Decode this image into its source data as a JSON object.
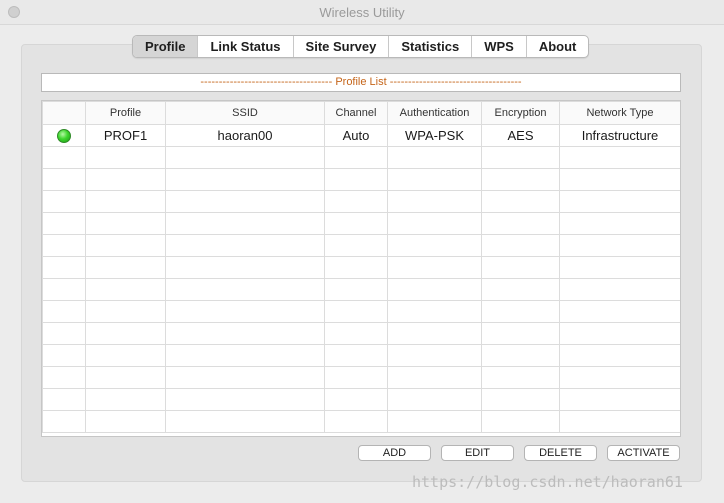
{
  "window": {
    "title": "Wireless Utility"
  },
  "tabs": [
    "Profile",
    "Link Status",
    "Site Survey",
    "Statistics",
    "WPS",
    "About"
  ],
  "active_tab": "Profile",
  "profile_list": {
    "header": "------------------------------------ Profile List ------------------------------------",
    "columns": [
      "",
      "Profile",
      "SSID",
      "Channel",
      "Authentication",
      "Encryption",
      "Network Type"
    ],
    "rows": [
      {
        "status": "connected-green",
        "profile": "PROF1",
        "ssid": "haoran00",
        "channel": "Auto",
        "authentication": "WPA-PSK",
        "encryption": "AES",
        "network_type": "Infrastructure"
      }
    ],
    "empty_row_count": 13
  },
  "buttons": {
    "add": "ADD",
    "edit": "EDIT",
    "delete": "DELETE",
    "activate": "ACTIVATE"
  },
  "watermark": "https://blog.csdn.net/haoran61",
  "colors": {
    "accent_text": "#c5651a",
    "status_led": "#3ed62d"
  }
}
